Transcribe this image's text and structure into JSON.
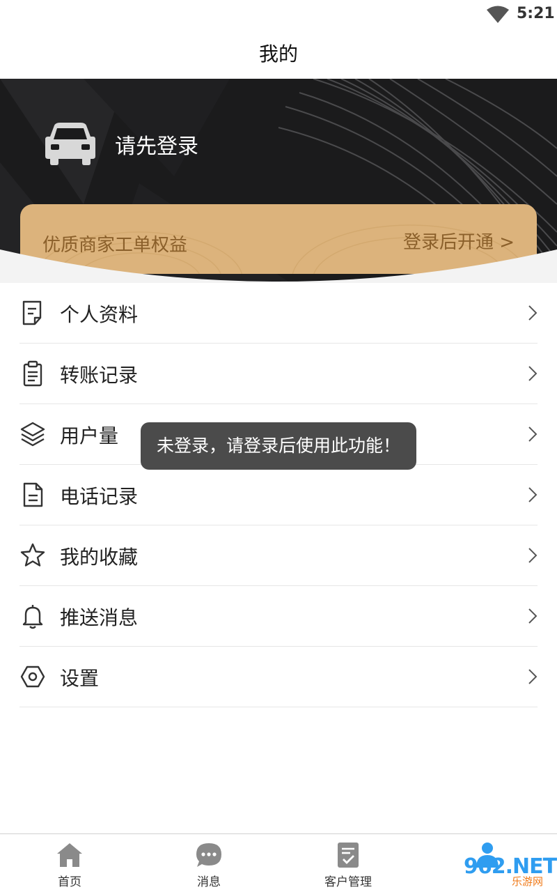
{
  "status_bar": {
    "time": "5:21"
  },
  "header": {
    "title": "我的"
  },
  "profile": {
    "login_prompt": "请先登录"
  },
  "vip_card": {
    "title": "优质商家工单权益",
    "action": "登录后开通 >"
  },
  "menu": {
    "items": [
      {
        "label": "个人资料",
        "icon": "profile-doc-icon"
      },
      {
        "label": "转账记录",
        "icon": "clipboard-icon"
      },
      {
        "label": "用户量",
        "icon": "layers-icon"
      },
      {
        "label": "电话记录",
        "icon": "file-icon"
      },
      {
        "label": "我的收藏",
        "icon": "star-icon"
      },
      {
        "label": "推送消息",
        "icon": "bell-icon"
      },
      {
        "label": "设置",
        "icon": "hexagon-settings-icon"
      }
    ]
  },
  "toast": {
    "message": "未登录，请登录后使用此功能！"
  },
  "tabbar": {
    "tabs": [
      {
        "label": "首页",
        "icon": "home-icon"
      },
      {
        "label": "消息",
        "icon": "chat-icon"
      },
      {
        "label": "客户管理",
        "icon": "document-check-icon"
      },
      {
        "label": "",
        "icon": "person-icon"
      }
    ]
  },
  "watermark": {
    "text": "962.NET",
    "sub": "乐游网"
  },
  "colors": {
    "vip_gold": "#dcb37c",
    "vip_text": "#8a5f2a",
    "hero_bg": "#1b1b1c",
    "toast_bg": "#4b4b4b"
  }
}
